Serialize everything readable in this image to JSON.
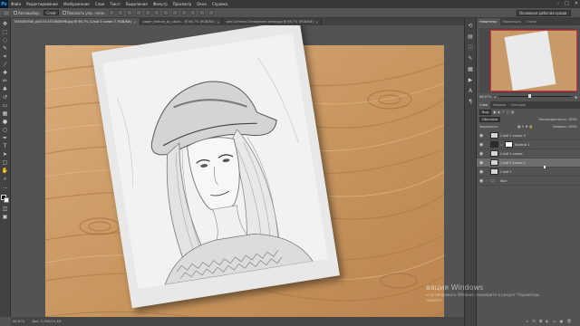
{
  "menubar": {
    "logo": "Ps",
    "items": [
      "Файл",
      "Редактирование",
      "Изображение",
      "Слои",
      "Текст",
      "Выделение",
      "Фильтр",
      "Просмотр",
      "Окно",
      "Справка"
    ],
    "controls": [
      "–",
      "□",
      "✕"
    ]
  },
  "options": {
    "autoselect_label": "Автовыбор:",
    "autoselect_value": "Слой",
    "transform_label": "Показать упр. элем.",
    "workspace": "Основная рабочая среда"
  },
  "tabs": [
    {
      "label": "1545403540_ps01514752608Il98.jpg @ 66,7% (Слой 2 копия 3, RGB/8#)",
      "active": true
    },
    {
      "label": "paper_texture_by_stock... @ 66,7% (RGB/8#)",
      "active": false
    },
    {
      "label": "sale-Camera-Chebooksen-wood.jpg @ 66,7% (RGB/8#)",
      "active": false
    }
  ],
  "status": {
    "zoom": "66,67%",
    "doc": "Док: 2,70М/10,4М"
  },
  "navigator": {
    "tabs": [
      "Навигатор",
      "Коррекция",
      "Стили"
    ],
    "zoom": "66,67%"
  },
  "layers_panel": {
    "tabs": [
      "Слои",
      "Каналы",
      "Контуры"
    ],
    "filter_label": "Вид",
    "blend_mode": "Обычные",
    "opacity_label": "Непрозрачность:",
    "opacity_value": "100%",
    "lock_label": "Закрепить:",
    "fill_label": "Заливка:",
    "fill_value": "100%",
    "layers": [
      {
        "name": "Слой 2 копия 3",
        "visible": true,
        "selected": false,
        "kind": "sketch"
      },
      {
        "name": "Уровни 1",
        "visible": true,
        "selected": false,
        "kind": "adjust"
      },
      {
        "name": "Слой 2 копия",
        "visible": true,
        "selected": false,
        "kind": "sketch"
      },
      {
        "name": "Слой 2 копия 2",
        "visible": true,
        "selected": true,
        "kind": "sketch"
      },
      {
        "name": "Слой 2",
        "visible": true,
        "selected": false,
        "kind": "sketch"
      },
      {
        "name": "Фон",
        "visible": true,
        "selected": false,
        "kind": "folder"
      }
    ]
  },
  "watermark": {
    "title": "вация Windows",
    "subtitle1": "ы активировать Windows, перейдите в раздел \"Параметры",
    "subtitle2": "перейте"
  },
  "colors": {
    "accent": "#31a8ff",
    "nav_box": "#e12d2d",
    "wood": "#c89a6a"
  }
}
